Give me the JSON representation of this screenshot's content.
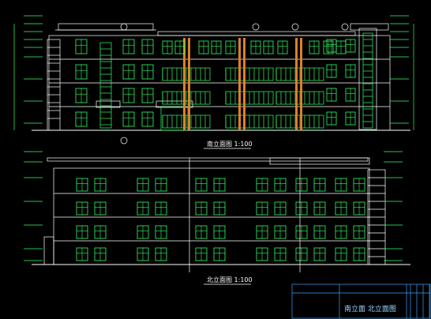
{
  "drawing": {
    "south_title": "南立面图 1:100",
    "north_title": "北立面图 1:100",
    "sheet_title": "南立面  北立面图"
  },
  "colors": {
    "background": "#000000",
    "outline": "#ffffff",
    "window": "#33ff66",
    "column": "#d9822b",
    "dimension": "#33ff66",
    "title_block": "#3aa0ff"
  }
}
